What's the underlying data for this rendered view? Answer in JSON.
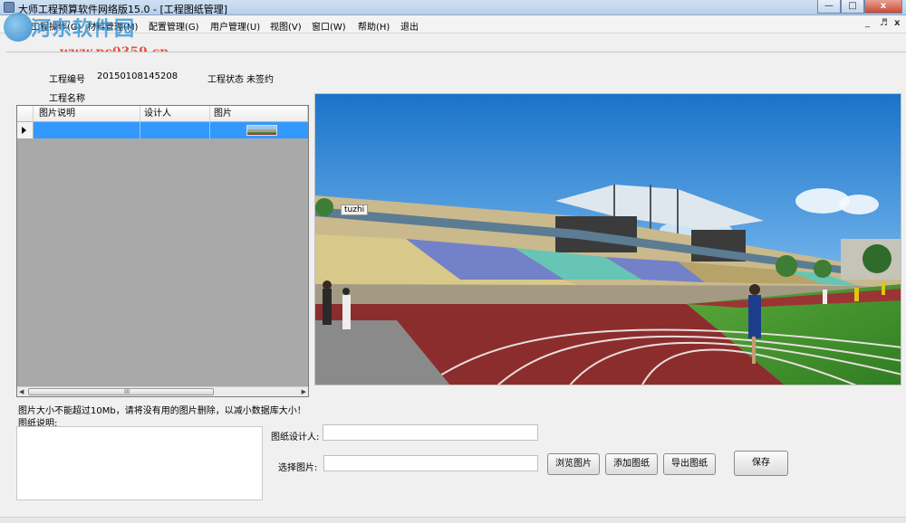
{
  "window": {
    "title": "大师工程预算软件网络版15.0 - [工程图纸管理]",
    "controls": [
      "—",
      "□",
      "x"
    ]
  },
  "watermark": {
    "site": "河东软件园",
    "url": "www.pc0359.cn"
  },
  "menu": {
    "items": [
      "工程操作(G)",
      "材料管理(M)",
      "配置管理(G)",
      "用户管理(U)",
      "视图(V)",
      "窗口(W)",
      "帮助(H)",
      "退出"
    ],
    "mdi_controls": [
      "_",
      "♬",
      "x"
    ]
  },
  "project": {
    "id_label": "工程编号",
    "id_value": "20150108145208",
    "status_label": "工程状态",
    "status_value": "未签约",
    "name_label": "工程名称"
  },
  "grid": {
    "columns": [
      "图片说明",
      "设计人",
      "图片"
    ],
    "scroll_grip": "III"
  },
  "photo": {
    "caption": "tuzhi"
  },
  "notice": "图片大小不能超过10Mb，请将没有用的图片删除，以减小数据库大小！",
  "form": {
    "desc_label": "图纸说明:",
    "designer_label": "图纸设计人:",
    "designer_value": "",
    "select_label": "选择图片:",
    "select_value": ""
  },
  "buttons": {
    "browse": "浏览图片",
    "add": "添加图纸",
    "export": "导出图纸",
    "save": "保存"
  }
}
